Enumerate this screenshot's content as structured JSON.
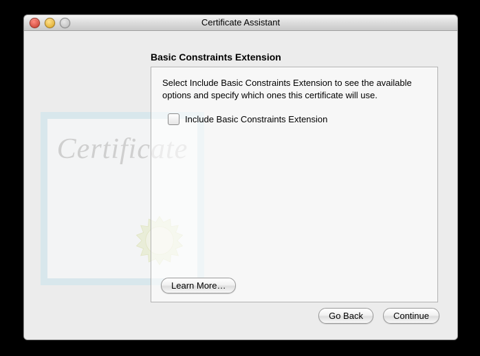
{
  "window": {
    "title": "Certificate Assistant"
  },
  "page": {
    "heading": "Basic Constraints Extension",
    "description": "Select Include Basic Constraints Extension to see the available options and specify which ones this certificate will use.",
    "checkbox_label": "Include Basic Constraints Extension"
  },
  "buttons": {
    "learn_more": "Learn More…",
    "go_back": "Go Back",
    "continue": "Continue"
  },
  "decor": {
    "certificate_word": "Certificate"
  }
}
